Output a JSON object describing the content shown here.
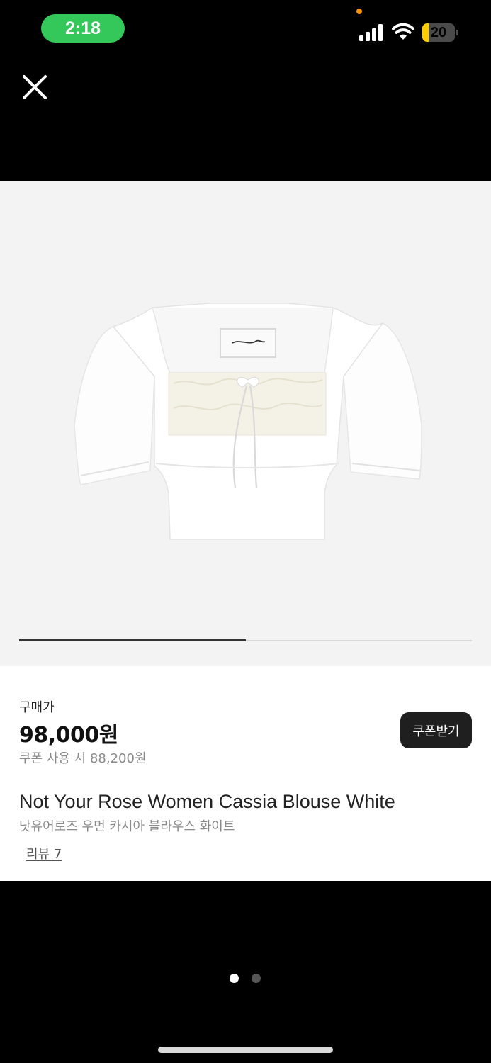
{
  "status_bar": {
    "time": "2:18",
    "battery_level": "20",
    "battery_fraction": 0.2,
    "icons": [
      "signal-icon",
      "wifi-icon",
      "battery-icon"
    ]
  },
  "header": {
    "close_icon": "close-icon"
  },
  "gallery": {
    "image_icon": "blouse-product-image",
    "progress_fraction": 0.5
  },
  "product": {
    "price_label": "구매가",
    "price": "98,000원",
    "coupon_price": "쿠폰 사용 시 88,200원",
    "coupon_button": "쿠폰받기",
    "name_en": "Not Your Rose Women Cassia Blouse White",
    "name_ko": "낫유어로즈 우먼 카시아 블라우스 화이트",
    "review_link": "리뷰 7"
  },
  "pager": {
    "total": 2,
    "active": 1
  },
  "colors": {
    "time_pill": "#34c759",
    "coupon_button_bg": "#1f1f1f",
    "image_bg": "#f3f3f4",
    "progress": "#333333"
  }
}
